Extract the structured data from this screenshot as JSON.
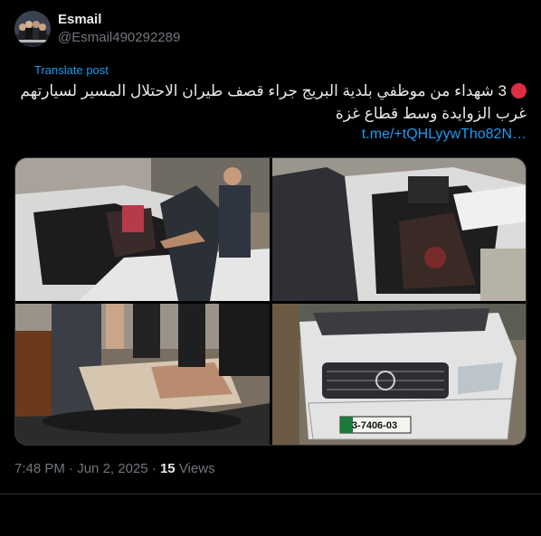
{
  "author": {
    "name": "Esmail",
    "handle": "@Esmail490292289"
  },
  "post": {
    "translate_label": "Translate post",
    "text_line1": "3 شهداء من موظفي بلدية البريج جراء قصف طيران الاحتلال المسير لسيارتهم",
    "text_line2": "غرب الزوايدة وسط قطاع غزة",
    "link_text": "t.me/+tQHLyywTho82N…",
    "red_circle_icon": "red-circle-emoji"
  },
  "media": {
    "count": 4,
    "images": [
      {
        "description_name": "destroyed-car-door-with-man"
      },
      {
        "description_name": "car-interior-damage"
      },
      {
        "description_name": "victim-on-ground"
      },
      {
        "description_name": "car-front-with-plate"
      }
    ],
    "license_plate": "3-7406-03"
  },
  "meta": {
    "time": "7:48 PM",
    "separator": "·",
    "date": "Jun 2, 2025",
    "views_count": "15",
    "views_label": "Views"
  },
  "colors": {
    "background": "#000000",
    "primary_text": "#e7e9ea",
    "secondary_text": "#71767b",
    "link": "#1d9bf0",
    "divider": "#2f3336",
    "emoji_red": "#dd2e44"
  }
}
